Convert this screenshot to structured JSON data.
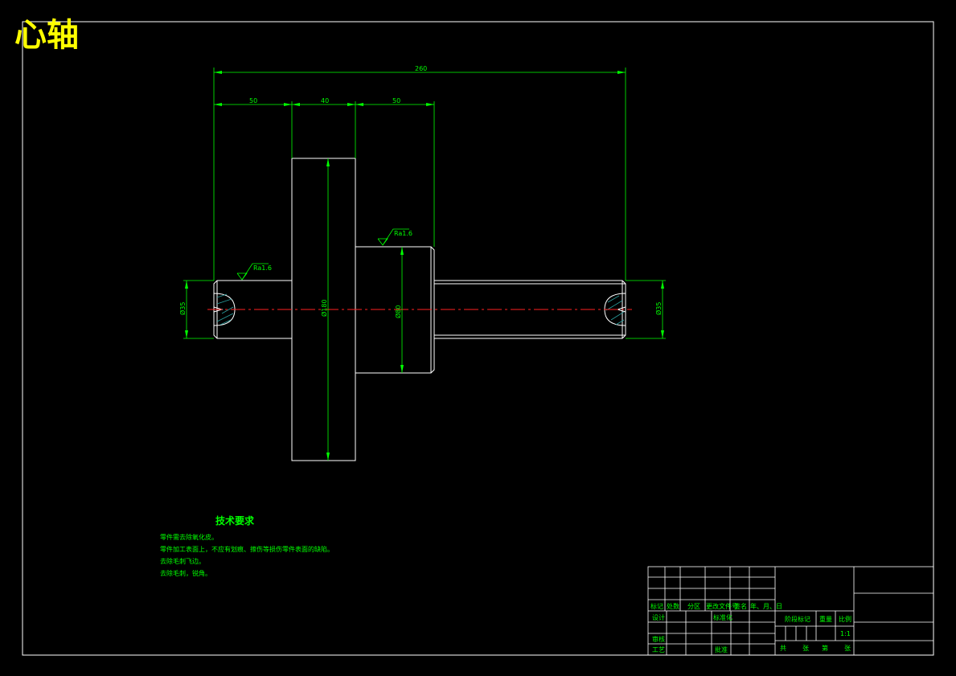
{
  "drawing_title": "心轴",
  "dimensions": {
    "overall_length": "260",
    "seg1": "50",
    "seg2": "40",
    "seg3": "50",
    "dia_left": "Ø35",
    "dia_flange": "Ø180",
    "dia_mid": "Ø80",
    "dia_right": "Ø35"
  },
  "roughness": {
    "r1": "Ra1.6",
    "r2": "Ra1.6"
  },
  "tech_requirements": {
    "heading": "技术要求",
    "items": [
      "零件需去除氧化皮。",
      "零件加工表面上，不应有划痕、擦伤等损伤零件表面的缺陷。",
      "去除毛刺飞边。",
      "去除毛刺，锐角。"
    ]
  },
  "title_block": {
    "col_mark": "标记",
    "col_count": "处数",
    "col_zone": "分区",
    "col_doc": "更改文件号",
    "col_sign": "签名",
    "col_date": "年、月、日",
    "design": "设计",
    "standardize": "标准化",
    "review": "审核",
    "process": "工艺",
    "approve": "批准",
    "stage_mark": "阶段标记",
    "weight": "重量",
    "scale_label": "比例",
    "scale_value": "1:1",
    "total": "共",
    "sheets": "张",
    "page": "第",
    "page_end": "张"
  }
}
